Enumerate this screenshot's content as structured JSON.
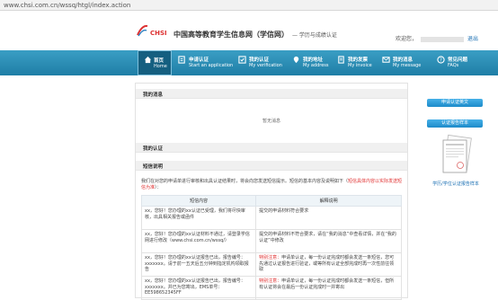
{
  "browser": {
    "url": "www.chsi.com.cn/wssq/htgl/index.action"
  },
  "header": {
    "logo_text": "CHSI",
    "site_title": "中国高等教育学生信息网（学信网）",
    "site_subtitle": "— 学历与成绩认证",
    "welcome_label": "欢迎您，",
    "logout_label": "退出"
  },
  "nav": {
    "items": [
      {
        "cn": "首页",
        "en": "Home",
        "icon": "home-icon"
      },
      {
        "cn": "申请认证",
        "en": "Start an application",
        "icon": "apply-icon"
      },
      {
        "cn": "我的认证",
        "en": "My verification",
        "icon": "verification-icon"
      },
      {
        "cn": "我的地址",
        "en": "My address",
        "icon": "address-icon"
      },
      {
        "cn": "我的发票",
        "en": "My invoice",
        "icon": "invoice-icon"
      },
      {
        "cn": "我的消息",
        "en": "My message",
        "icon": "message-icon"
      },
      {
        "cn": "常见问题",
        "en": "FAQs",
        "icon": "faq-icon"
      }
    ]
  },
  "main": {
    "messages_title": "我的消息",
    "messages_empty": "暂无消息",
    "verification_title": "我的认证",
    "sms_title": "短信说明",
    "sms_desc": "我们在对您的申请单进行审核和出具认证结果时，将会向您发送短信提示。短信的基本内容及说明如下（",
    "sms_desc_red": "短信具体内容以实际发送短信为准",
    "sms_desc_end": "）：",
    "table": {
      "headers": [
        "短信内容",
        "解释说明"
      ],
      "rows": [
        {
          "content": "xx，您好！您办理的xx认证已受理，我们将尽快审核，出具相关报告或函件",
          "note_red": "",
          "note": "提交的申请材料符合要求"
        },
        {
          "content": "xx，您好！您办理的xx认证材料不通过，请登录学信网进行修改（www.chsi.com.cn/wssq/）",
          "note_red": "",
          "note": "提交的申请材料不符合要求，请在“我的消息”中查看详情，并在“我的认证”中修改"
        },
        {
          "content": "xx，您好！您办理的xx认证报告已出，报告编号：xxxxxxx。请于前一五天后五分钟到指定机构领取报告",
          "note_red": "特别注意：",
          "note": "申请单认证，每一份认证完成时都会发送一条短信，您可先通过认证报告进行验证，或等所有认证全部完成时再一次性前往领取"
        },
        {
          "content": "xx，您好！您办理的xx认证报告已出，报告编号：xxxxxxx。并已为您寄出，EMS单号：EE598652345FF",
          "note_red": "特别注意：",
          "note": "申请单认证，每一份认证完成时都会发送一条短信，但所有认证将会在最后一份认证完成时一并寄出"
        }
      ]
    }
  },
  "sidebar": {
    "apply_button": "申请认证英文",
    "download_button": "认证报告样本",
    "sample_link": "学历/学位认证报告样本"
  },
  "colors": {
    "nav": "#2589b2",
    "accent_button": "#2a97d6",
    "warning": "#e03030"
  }
}
